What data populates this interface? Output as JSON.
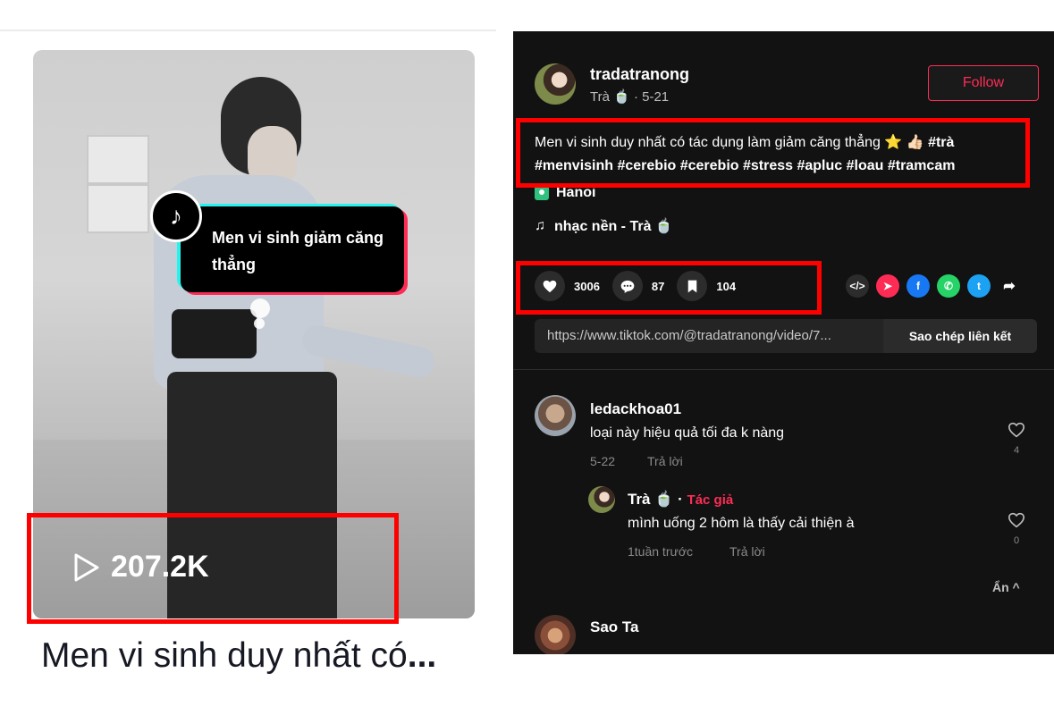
{
  "video_card": {
    "overlay_text": "Men vi sinh giảm căng thẳng",
    "views": "207.2K",
    "title_prefix": "Men vi sinh duy nhất có",
    "title_ellipsis": "..."
  },
  "post": {
    "author": "tradatranong",
    "author_sub": "Trà 🍵 · 5-21",
    "follow_label": "Follow",
    "description_text": "Men vi sinh duy nhất có tác dụng làm giảm căng thẳng ⭐ 👍🏻 ",
    "hashtags": "#trà #menvisinh #cerebio #cerebio #stress #apluc #loau #tramcam",
    "location": "Hanoi",
    "music": "nhạc nền - Trà 🍵",
    "likes": "3006",
    "comments": "87",
    "bookmarks": "104",
    "link": "https://www.tiktok.com/@tradatranong/video/7...",
    "copy_label": "Sao chép liên kết"
  },
  "share_icons": [
    "embed-icon",
    "send-icon",
    "facebook-icon",
    "whatsapp-icon",
    "twitter-icon",
    "share-arrow-icon"
  ],
  "comments": [
    {
      "user": "ledackhoa01",
      "text": "loại này hiệu quả tối đa k nàng",
      "date": "5-22",
      "reply_label": "Trả lời",
      "likes": "4"
    },
    {
      "user": "Trà 🍵",
      "author_tag": "Tác giả",
      "text": "mình uống 2 hôm là thấy cải thiện à",
      "date": "1tuần trước",
      "reply_label": "Trả lời",
      "likes": "0"
    },
    {
      "user": "Sao Ta"
    }
  ],
  "hide_label": "Ẩn ^",
  "colors": {
    "panel_bg": "#121212",
    "accent": "#fe2c55",
    "annotation": "#ff0000"
  }
}
